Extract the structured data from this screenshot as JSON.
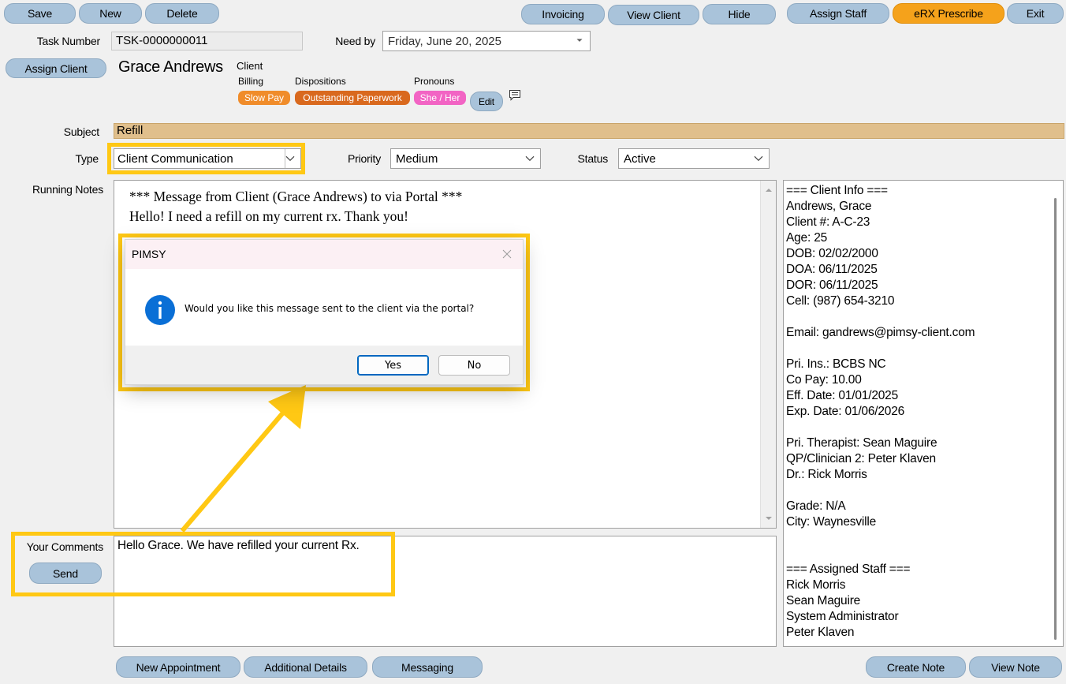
{
  "toolbar": {
    "save": "Save",
    "new": "New",
    "delete": "Delete",
    "invoicing": "Invoicing",
    "view_client": "View Client",
    "hide": "Hide",
    "assign_staff": "Assign Staff",
    "erx": "eRX Prescribe",
    "exit": "Exit"
  },
  "task": {
    "task_number_label": "Task Number",
    "task_number": "TSK-0000000011",
    "need_by_label": "Need by",
    "need_by": "Friday, June 20, 2025"
  },
  "client": {
    "assign_button": "Assign Client",
    "name": "Grace Andrews",
    "client_label": "Client",
    "billing_label": "Billing",
    "dispositions_label": "Dispositions",
    "pronouns_label": "Pronouns",
    "billing_tag": "Slow Pay",
    "disposition_tag": "Outstanding Paperwork",
    "pronoun_tag": "She / Her",
    "edit": "Edit"
  },
  "form": {
    "subject_label": "Subject",
    "subject": "Refill",
    "type_label": "Type",
    "type": "Client Communication",
    "priority_label": "Priority",
    "priority": "Medium",
    "status_label": "Status",
    "status": "Active",
    "running_notes_label": "Running Notes",
    "notes_line1": "*** Message from Client (Grace Andrews) to via Portal ***",
    "notes_line2": "Hello! I need a refill on my current rx. Thank you!",
    "comments_label": "Your Comments",
    "send": "Send",
    "comment": "Hello Grace. We have refilled your current Rx."
  },
  "client_info": [
    "=== Client Info ===",
    "Andrews, Grace",
    "Client #: A-C-23",
    "Age: 25",
    "DOB: 02/02/2000",
    "DOA: 06/11/2025",
    "DOR: 06/11/2025",
    "Cell: (987) 654-3210",
    "",
    "Email: gandrews@pimsy-client.com",
    "",
    "Pri. Ins.: BCBS NC",
    "Co Pay: 10.00",
    "Eff. Date: 01/01/2025",
    "Exp. Date: 01/06/2026",
    "",
    "Pri. Therapist: Sean Maguire",
    "QP/Clinician 2: Peter Klaven",
    "Dr.: Rick Morris",
    "",
    "Grade: N/A",
    "City: Waynesville",
    "",
    "",
    "=== Assigned Staff ===",
    "Rick Morris",
    "Sean Maguire",
    "System Administrator",
    "Peter Klaven"
  ],
  "bottom": {
    "new_appointment": "New Appointment",
    "additional_details": "Additional Details",
    "messaging": "Messaging",
    "create_note": "Create Note",
    "view_note": "View Note"
  },
  "dialog": {
    "title": "PIMSY",
    "message": "Would you like this message sent to the client via the portal?",
    "yes": "Yes",
    "no": "No"
  },
  "colors": {
    "button": "#a9c3da",
    "erx": "#f5a21b",
    "subject_bg": "#e0bf8c",
    "highlight": "#ffc814",
    "billing_tag": "#f08c2a",
    "disposition_tag": "#d9691e",
    "pronoun_tag": "#f264c4",
    "info_icon": "#0a6fd6"
  }
}
